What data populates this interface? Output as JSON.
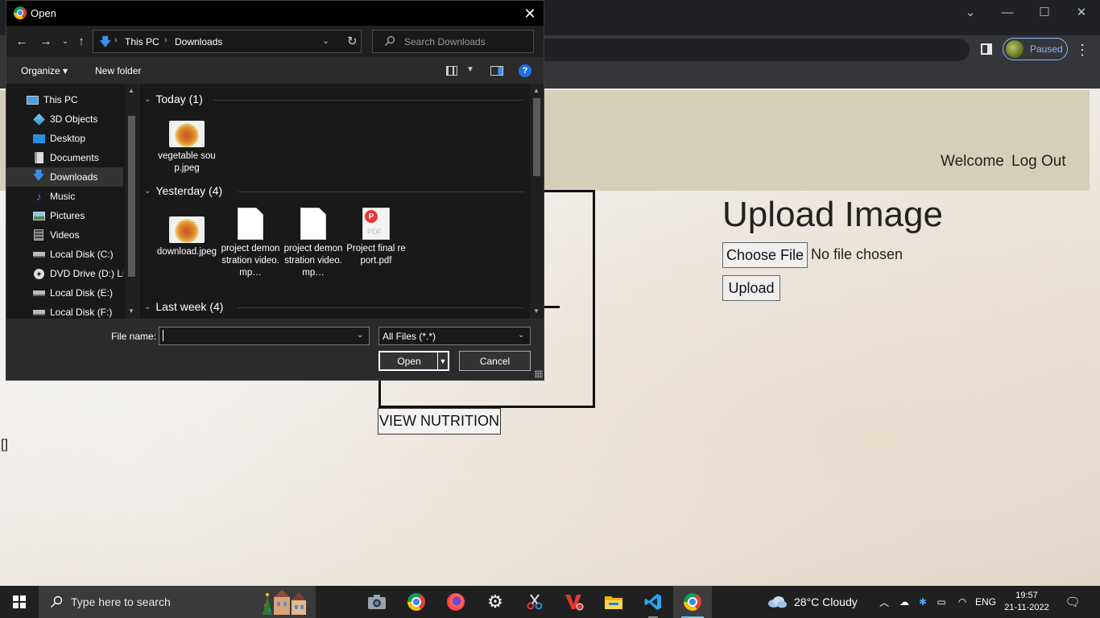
{
  "browser": {
    "profile_status": "Paused",
    "window_controls": {
      "minimize": "—",
      "maximize": "☐",
      "close": "✕",
      "tabs_menu": "⌄"
    }
  },
  "webpage": {
    "nav": {
      "welcome": "Welcome",
      "logout": "Log Out"
    },
    "upload_title": "Upload Image",
    "choose_file_label": "Choose File",
    "file_status": "No file chosen",
    "upload_label": "Upload",
    "view_nutrition_label": "VIEW NUTRITION",
    "output_text": "[]"
  },
  "dialog": {
    "title": "Open",
    "close": "✕",
    "nav_buttons": {
      "back": "←",
      "forward": "→",
      "recent": "⌄",
      "up": "↑"
    },
    "breadcrumb": [
      "This PC",
      "Downloads"
    ],
    "breadcrumb_sep": "›",
    "search_placeholder": "Search Downloads",
    "commands": {
      "organize": "Organize ▾",
      "new_folder": "New folder"
    },
    "tree": [
      {
        "label": "This PC",
        "icon": "pc-icon"
      },
      {
        "label": "3D Objects",
        "icon": "cube-icon"
      },
      {
        "label": "Desktop",
        "icon": "desktop-icon"
      },
      {
        "label": "Documents",
        "icon": "documents-icon"
      },
      {
        "label": "Downloads",
        "icon": "download-icon",
        "selected": true
      },
      {
        "label": "Music",
        "icon": "music-icon"
      },
      {
        "label": "Pictures",
        "icon": "pictures-icon"
      },
      {
        "label": "Videos",
        "icon": "videos-icon"
      },
      {
        "label": "Local Disk (C:)",
        "icon": "drive-icon"
      },
      {
        "label": "DVD Drive (D:) Lir",
        "icon": "dvd-icon"
      },
      {
        "label": "Local Disk (E:)",
        "icon": "drive-icon"
      },
      {
        "label": "Local Disk (F:)",
        "icon": "drive-icon"
      }
    ],
    "groups": [
      {
        "label": "Today (1)",
        "files": [
          {
            "name": "vegetable soup.jpeg",
            "type": "image"
          }
        ]
      },
      {
        "label": "Yesterday (4)",
        "files": [
          {
            "name": "download.jpeg",
            "type": "image"
          },
          {
            "name": "project demonstration video.mp…",
            "type": "blank"
          },
          {
            "name": "project demonstration video.mp…",
            "type": "blank"
          },
          {
            "name": "Project final report.pdf",
            "type": "pdf"
          }
        ]
      },
      {
        "label": "Last week (4)",
        "files": []
      }
    ],
    "filename_label": "File name:",
    "filename_value": "",
    "filetype_value": "All Files (*.*)",
    "open_label": "Open",
    "cancel_label": "Cancel",
    "pdf_badge": "PDF"
  },
  "taskbar": {
    "search_placeholder": "Type here to search",
    "apps": [
      {
        "name": "camera-app",
        "state": "normal"
      },
      {
        "name": "chrome-app",
        "state": "normal"
      },
      {
        "name": "firefox-app",
        "state": "normal"
      },
      {
        "name": "settings-app",
        "state": "normal"
      },
      {
        "name": "snipping-tool-app",
        "state": "normal"
      },
      {
        "name": "v2-app",
        "state": "normal"
      },
      {
        "name": "file-explorer-app",
        "state": "normal"
      },
      {
        "name": "vscode-app",
        "state": "running"
      },
      {
        "name": "chrome-app-active",
        "state": "active"
      }
    ],
    "weather": "28°C  Cloudy",
    "language": "ENG",
    "time": "19:57",
    "date": "21-11-2022"
  },
  "colors": {
    "accent_blue": "#3b8eea",
    "header_beige": "#d5cfb9",
    "dialog_bg": "#2b2b2b",
    "taskbar_bg": "#202020"
  }
}
